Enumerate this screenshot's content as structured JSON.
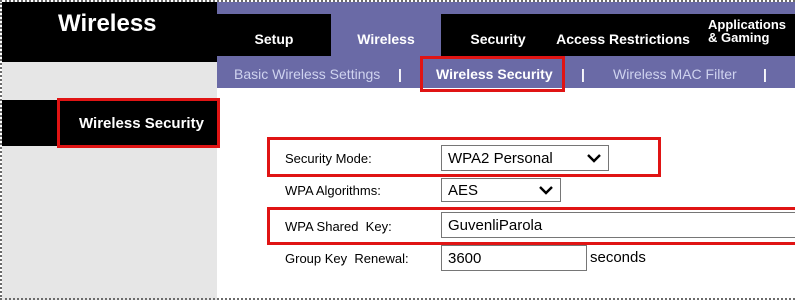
{
  "header": {
    "title": "Wireless"
  },
  "top_tabs": [
    {
      "label": "Setup"
    },
    {
      "label": "Wireless"
    },
    {
      "label": "Security"
    },
    {
      "label": "Access Restrictions"
    },
    {
      "label_line1": "Applications",
      "label_line2": "& Gaming"
    }
  ],
  "sub_tabs": [
    {
      "label": "Basic Wireless Settings"
    },
    {
      "label": "Wireless Security"
    },
    {
      "label": "Wireless MAC Filter"
    }
  ],
  "separator": "|",
  "section": {
    "title": "Wireless Security"
  },
  "form": {
    "security_mode": {
      "label": "Security Mode:",
      "value": "WPA2 Personal"
    },
    "wpa_algorithms": {
      "label": "WPA Algorithms:",
      "value": "AES"
    },
    "wpa_shared_key": {
      "label": "WPA Shared  Key:",
      "value": "GuvenliParola"
    },
    "group_key_renewal": {
      "label": "Group Key  Renewal:",
      "value": "3600",
      "unit": "seconds"
    }
  },
  "colors": {
    "nav_black": "#000000",
    "nav_purple": "#6a6aa6",
    "highlight_red": "#e01414",
    "left_gray": "#e6e6e6"
  }
}
